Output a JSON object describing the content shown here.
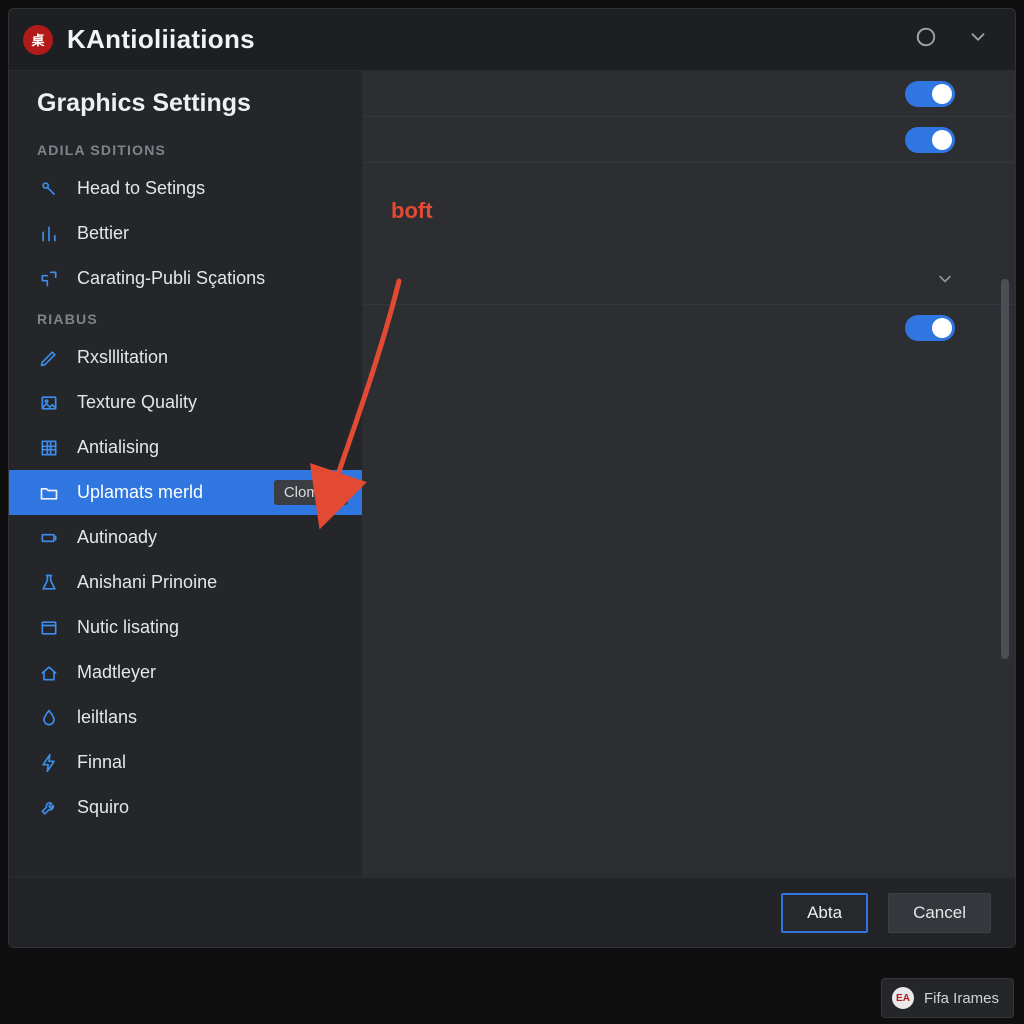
{
  "titlebar": {
    "app_glyph": "桌",
    "title": "KAntioliiations"
  },
  "sidebar": {
    "title": "Graphics Settings",
    "sections": [
      {
        "label": "ADILA SDITIONS",
        "items": [
          {
            "icon": "link-icon",
            "label": "Head to Setings"
          },
          {
            "icon": "bars-icon",
            "label": "Bettier"
          },
          {
            "icon": "puzzle-icon",
            "label": "Carating-Publi Sçations"
          }
        ]
      },
      {
        "label": "RIABUS",
        "items": [
          {
            "icon": "pencil-icon",
            "label": "Rxslllitation"
          },
          {
            "icon": "image-icon",
            "label": "Texture Quality"
          },
          {
            "icon": "grid-icon",
            "label": "Antialising"
          },
          {
            "icon": "folder-icon",
            "label": "Uplamats merld",
            "selected": true,
            "chip": "Clomies"
          },
          {
            "icon": "battery-icon",
            "label": "Autinoady"
          },
          {
            "icon": "flask-icon",
            "label": "Anishani Prinoine"
          },
          {
            "icon": "window-icon",
            "label": "Nutic lisating"
          },
          {
            "icon": "house-icon",
            "label": "Madtleyer"
          },
          {
            "icon": "drop-icon",
            "label": "leiltlans"
          },
          {
            "icon": "bolt-icon",
            "label": "Finnal"
          },
          {
            "icon": "tool-icon",
            "label": "Squiro"
          }
        ]
      }
    ]
  },
  "main": {
    "rows": [
      {
        "type": "toggle",
        "label": "",
        "on": true
      },
      {
        "type": "toggle",
        "label": "",
        "on": true
      },
      {
        "type": "label",
        "red_text": "boft"
      },
      {
        "type": "dropdown",
        "label": ""
      },
      {
        "type": "toggle",
        "label": "",
        "on": true
      }
    ]
  },
  "footer": {
    "primary": "Abta",
    "secondary": "Cancel"
  },
  "statusbar": {
    "badge": "EA",
    "text": "Fifa Irames"
  }
}
